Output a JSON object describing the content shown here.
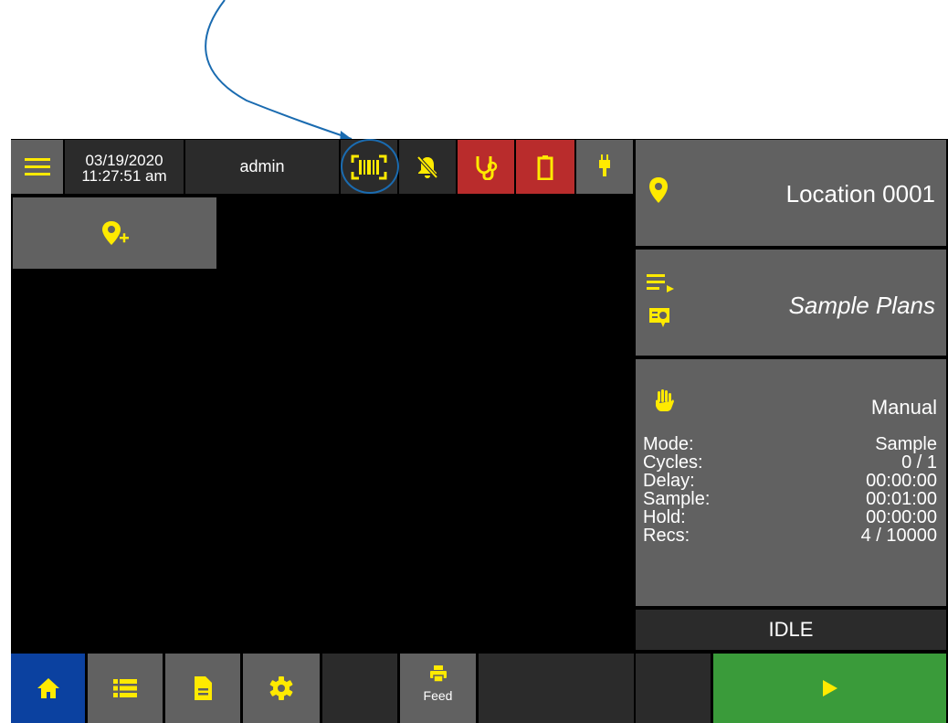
{
  "header": {
    "date": "03/19/2020",
    "time": "11:27:51 am",
    "user": "admin"
  },
  "icons": {
    "menu": "hamburger-menu-icon",
    "barcode": "barcode-scanner-icon",
    "alarm": "alarm-off-icon",
    "diagnostics": "stethoscope-icon",
    "battery": "battery-icon",
    "power": "plug-icon",
    "add_location": "add-location-icon",
    "location": "location-pin-icon",
    "plans_list": "playlist-icon",
    "plans_badge": "certificate-icon",
    "manual": "hand-icon",
    "home": "home-icon",
    "list": "list-icon",
    "document": "document-icon",
    "settings": "gear-icon",
    "printer": "printer-icon",
    "play": "play-icon"
  },
  "right_panel": {
    "location_label": "Location 0001",
    "sample_plans_label": "Sample Plans",
    "mode_title": "Manual",
    "stats": [
      {
        "label": "Mode:",
        "value": "Sample"
      },
      {
        "label": "Cycles:",
        "value": "0 / 1"
      },
      {
        "label": "Delay:",
        "value": "00:00:00"
      },
      {
        "label": "Sample:",
        "value": "00:01:00"
      },
      {
        "label": "Hold:",
        "value": "00:00:00"
      },
      {
        "label": "Recs:",
        "value": "4 / 10000"
      }
    ],
    "status": "IDLE"
  },
  "footer": {
    "feed_label": "Feed"
  },
  "colors": {
    "accent_yellow": "#ffea00",
    "panel_grey": "#616161",
    "dark_cell": "#2b2b2b",
    "alert_red": "#b92c2c",
    "home_blue": "#0b41a0",
    "start_green": "#3a9b3a",
    "annotation_blue": "#1a6bb0"
  }
}
